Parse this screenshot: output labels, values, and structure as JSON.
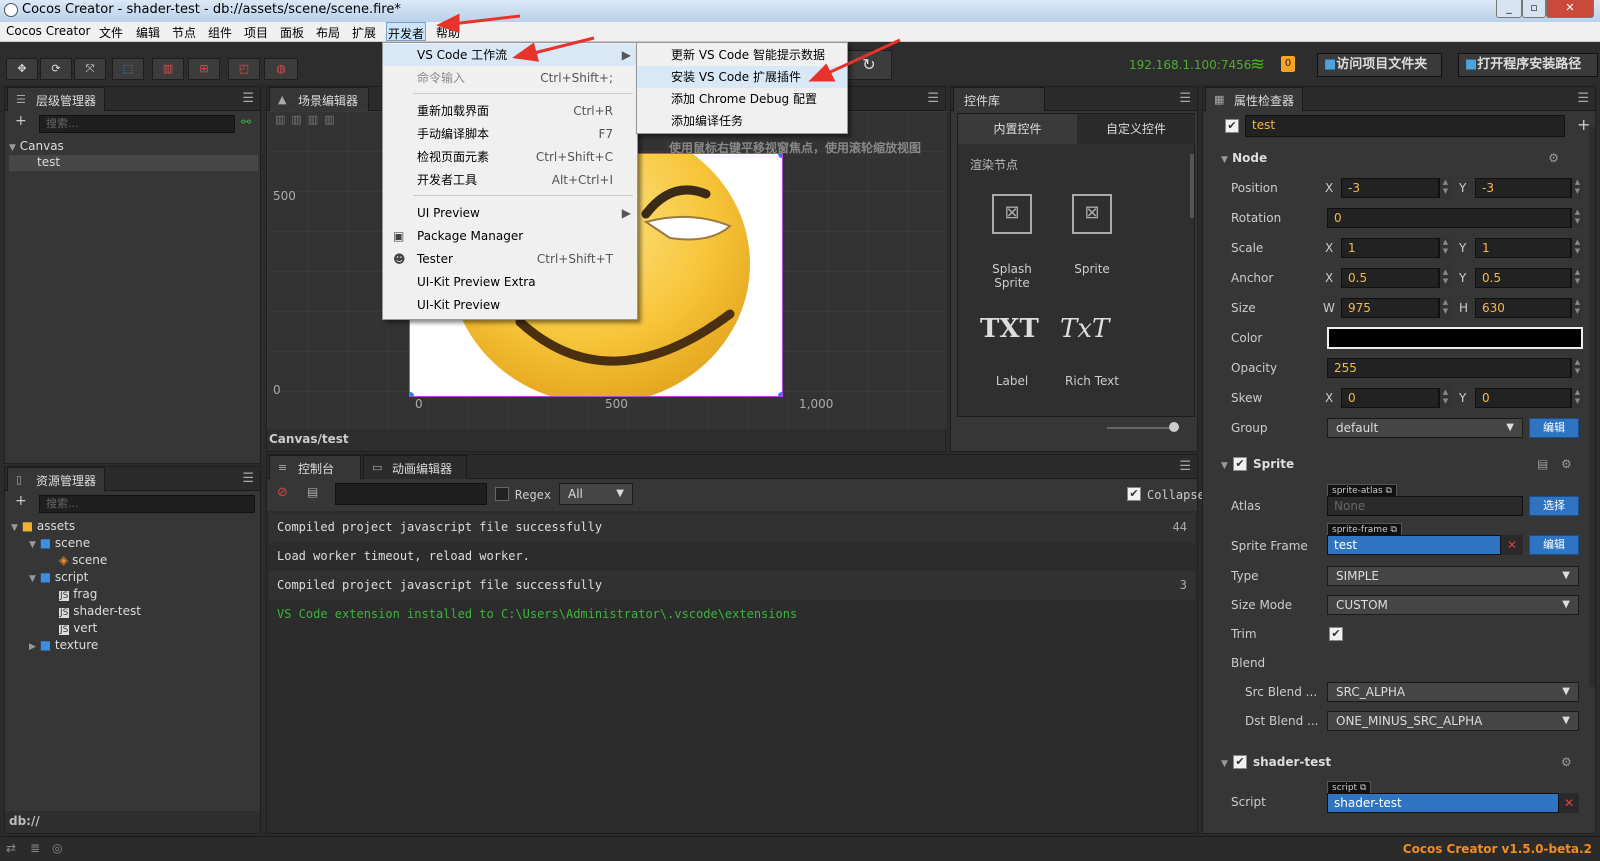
{
  "window": {
    "title": "Cocos Creator - shader-test - db://assets/scene/scene.fire*"
  },
  "menubar": [
    "Cocos Creator",
    "文件",
    "编辑",
    "节点",
    "组件",
    "项目",
    "面板",
    "布局",
    "扩展",
    "开发者",
    "帮助"
  ],
  "toolbar": {
    "ip": "192.168.1.100:7456",
    "badge": "0",
    "open_project_folder": "访问项目文件夹",
    "open_install_path": "打开程序安装路径"
  },
  "hierarchy": {
    "title": "层级管理器",
    "search_placeholder": "搜索...",
    "items": [
      "Canvas",
      "test"
    ]
  },
  "scene": {
    "title": "场景编辑器",
    "hint": "使用鼠标右键平移视窗焦点，使用滚轮缩放视图",
    "ruler_y": [
      "500",
      "0"
    ],
    "ruler_x": [
      "0",
      "500",
      "1,000"
    ],
    "footer": "Canvas/test"
  },
  "devmenu": {
    "items": [
      {
        "label": "VS Code 工作流",
        "shortcut": "",
        "submenu": true
      },
      {
        "label": "命令输入",
        "shortcut": "Ctrl+Shift+;"
      },
      {
        "label": "重新加载界面",
        "shortcut": "Ctrl+R"
      },
      {
        "label": "手动编译脚本",
        "shortcut": "F7"
      },
      {
        "label": "检视页面元素",
        "shortcut": "Ctrl+Shift+C"
      },
      {
        "label": "开发者工具",
        "shortcut": "Alt+Ctrl+I"
      },
      {
        "label": "UI Preview",
        "shortcut": "",
        "submenu": true
      },
      {
        "label": "Package Manager",
        "shortcut": ""
      },
      {
        "label": "Tester",
        "shortcut": "Ctrl+Shift+T"
      },
      {
        "label": "UI-Kit Preview Extra",
        "shortcut": ""
      },
      {
        "label": "UI-Kit Preview",
        "shortcut": ""
      }
    ]
  },
  "vscodemenu": {
    "items": [
      "更新 VS Code 智能提示数据",
      "安装 VS Code 扩展插件",
      "添加 Chrome Debug 配置",
      "添加编译任务"
    ]
  },
  "widgets": {
    "title": "控件库",
    "tabs": [
      "内置控件",
      "自定义控件"
    ],
    "section": "渲染节点",
    "items": [
      "Splash Sprite",
      "Sprite",
      "Label",
      "Rich Text"
    ],
    "glyph_label": "TXT",
    "glyph_richtext": "TxT"
  },
  "assets": {
    "title": "资源管理器",
    "search_placeholder": "搜索...",
    "items": [
      "assets",
      "scene",
      "scene",
      "script",
      "frag",
      "shader-test",
      "vert",
      "texture"
    ],
    "footer": "db://"
  },
  "console": {
    "tabs": [
      "控制台",
      "动画编辑器"
    ],
    "regex_label": "Regex",
    "filter_value": "All",
    "collapse_label": "Collapse",
    "rows": [
      {
        "text": "Compiled project javascript file successfully",
        "count": "44"
      },
      {
        "text": "Load worker timeout, reload worker.",
        "count": ""
      },
      {
        "text": "Compiled project javascript file successfully",
        "count": "3"
      },
      {
        "text": "VS Code extension installed to C:\\Users\\Administrator\\.vscode\\extensions",
        "count": ""
      }
    ]
  },
  "inspector": {
    "title": "属性检查器",
    "node_name": "test",
    "node_section": "Node",
    "position": {
      "label": "Position",
      "x": "-3",
      "y": "-3"
    },
    "rotation": {
      "label": "Rotation",
      "value": "0"
    },
    "scale": {
      "label": "Scale",
      "x": "1",
      "y": "1"
    },
    "anchor": {
      "label": "Anchor",
      "x": "0.5",
      "y": "0.5"
    },
    "size": {
      "label": "Size",
      "w": "975",
      "h": "630"
    },
    "color": {
      "label": "Color",
      "value": "#000000"
    },
    "opacity": {
      "label": "Opacity",
      "value": "255"
    },
    "skew": {
      "label": "Skew",
      "x": "0",
      "y": "0"
    },
    "group": {
      "label": "Group",
      "value": "default",
      "edit": "编辑"
    },
    "sprite_section": "Sprite",
    "atlas": {
      "label": "Atlas",
      "tag": "sprite-atlas",
      "value": "None",
      "btn": "选择"
    },
    "sprite_frame": {
      "label": "Sprite Frame",
      "tag": "sprite-frame",
      "value": "test",
      "btn": "编辑"
    },
    "type": {
      "label": "Type",
      "value": "SIMPLE"
    },
    "size_mode": {
      "label": "Size Mode",
      "value": "CUSTOM"
    },
    "trim": {
      "label": "Trim"
    },
    "blend": {
      "label": "Blend"
    },
    "src_blend": {
      "label": "Src Blend ...",
      "value": "SRC_ALPHA"
    },
    "dst_blend": {
      "label": "Dst Blend ...",
      "value": "ONE_MINUS_SRC_ALPHA"
    },
    "shader_section": "shader-test",
    "script": {
      "label": "Script",
      "tag": "script",
      "value": "shader-test"
    },
    "x_label": "X",
    "y_label": "Y",
    "w_label": "W",
    "h_label": "H"
  },
  "statusbar": {
    "version": "Cocos Creator v1.5.0-beta.2"
  },
  "colors": {
    "accent": "#2e74c2",
    "version": "#f28d1e",
    "ip": "#4caf2d",
    "log_green": "#3db33d"
  }
}
